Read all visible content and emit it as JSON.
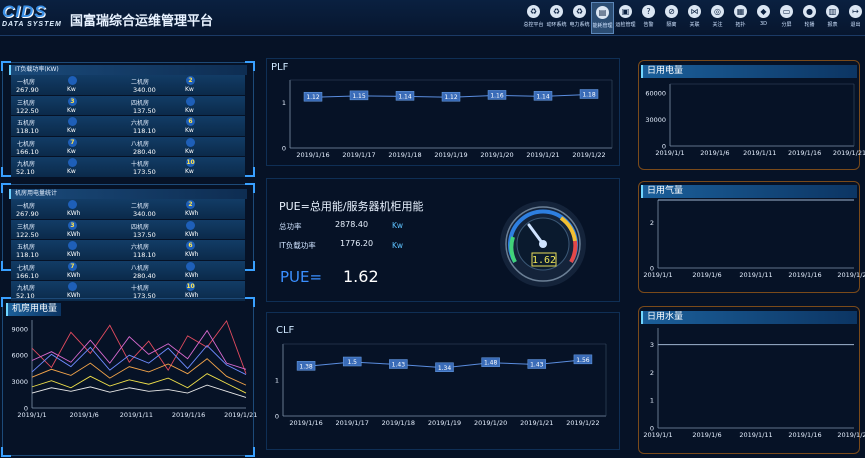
{
  "header": {
    "logo_big": "CIDS",
    "logo_small": "DATA SYSTEM",
    "title": "国富瑞综合运维管理平台",
    "nav": [
      {
        "label": "总控平台",
        "icon": "recycle-icon",
        "glyph": "♻"
      },
      {
        "label": "动环系统",
        "icon": "recycle-icon",
        "glyph": "♻"
      },
      {
        "label": "电力系统",
        "icon": "recycle-icon",
        "glyph": "♻"
      },
      {
        "label": "能耗管理",
        "icon": "bar-chart-icon",
        "glyph": "▤"
      },
      {
        "label": "运检管理",
        "icon": "box-icon",
        "glyph": "▣"
      },
      {
        "label": "告警",
        "icon": "question-icon",
        "glyph": "?"
      },
      {
        "label": "隔离",
        "icon": "slash-icon",
        "glyph": "⊘"
      },
      {
        "label": "关联",
        "icon": "share-icon",
        "glyph": "⋈"
      },
      {
        "label": "关注",
        "icon": "target-icon",
        "glyph": "◎"
      },
      {
        "label": "拓扑",
        "icon": "grid-icon",
        "glyph": "▦"
      },
      {
        "label": "3D",
        "icon": "cube-icon",
        "glyph": "◆"
      },
      {
        "label": "分屏",
        "icon": "screen-icon",
        "glyph": "▭"
      },
      {
        "label": "轮播",
        "icon": "pin-icon",
        "glyph": "●"
      },
      {
        "label": "报表",
        "icon": "doc-icon",
        "glyph": "▥"
      },
      {
        "label": "退出",
        "icon": "exit-icon",
        "glyph": "↦"
      }
    ],
    "active_nav": 3
  },
  "it_load": {
    "title": "IT负载功率(KW)",
    "rows": [
      {
        "left_name": "一机房",
        "left_val": "267.90",
        "left_num": "",
        "right_name": "二机房",
        "right_val": "340.00",
        "right_num": "2",
        "unit": "Kw"
      },
      {
        "left_name": "三机房",
        "left_val": "122.50",
        "left_num": "3",
        "right_name": "四机房",
        "right_val": "137.50",
        "right_num": "",
        "unit": "Kw"
      },
      {
        "left_name": "五机房",
        "left_val": "118.10",
        "left_num": "",
        "right_name": "六机房",
        "right_val": "118.10",
        "right_num": "6",
        "unit": "Kw"
      },
      {
        "left_name": "七机房",
        "left_val": "166.10",
        "left_num": "7",
        "right_name": "八机房",
        "right_val": "280.40",
        "right_num": "",
        "unit": "Kw"
      },
      {
        "left_name": "九机房",
        "left_val": "52.10",
        "left_num": "",
        "right_name": "十机房",
        "right_val": "173.50",
        "right_num": "10",
        "unit": "Kw"
      }
    ]
  },
  "room_power": {
    "title": "机房用电量统计",
    "rows": [
      {
        "left_name": "一机房",
        "left_val": "267.90",
        "left_num": "",
        "right_name": "二机房",
        "right_val": "340.00",
        "right_num": "2",
        "unit": "KWh"
      },
      {
        "left_name": "三机房",
        "left_val": "122.50",
        "left_num": "3",
        "right_name": "四机房",
        "right_val": "137.50",
        "right_num": "",
        "unit": "KWh"
      },
      {
        "left_name": "五机房",
        "left_val": "118.10",
        "left_num": "",
        "right_name": "六机房",
        "right_val": "118.10",
        "right_num": "6",
        "unit": "KWh"
      },
      {
        "left_name": "七机房",
        "left_val": "166.10",
        "left_num": "7",
        "right_name": "八机房",
        "right_val": "280.40",
        "right_num": "",
        "unit": "KWh"
      },
      {
        "left_name": "九机房",
        "left_val": "52.10",
        "left_num": "",
        "right_name": "十机房",
        "right_val": "173.50",
        "right_num": "10",
        "unit": "KWh"
      }
    ]
  },
  "pue": {
    "formula": "PUE=总用能/服务器机柜用能",
    "total_label": "总功率",
    "total_value": "2878.40",
    "total_unit": "Kw",
    "it_label": "IT负载功率",
    "it_value": "1776.20",
    "it_unit": "Kw",
    "pue_label": "PUE=",
    "pue_value": "1.62",
    "gauge_value": "1.62"
  },
  "chart_data": [
    {
      "id": "plf",
      "type": "line",
      "title": "PLF",
      "x": [
        "2019/1/16",
        "2019/1/17",
        "2019/1/18",
        "2019/1/19",
        "2019/1/20",
        "2019/1/21",
        "2019/1/22"
      ],
      "series": [
        {
          "values": [
            1.12,
            1.15,
            1.14,
            1.12,
            1.16,
            1.14,
            1.18
          ]
        }
      ],
      "ylim": [
        0,
        1.5
      ],
      "yticks": [
        0,
        1
      ],
      "data_labels": [
        "1.12",
        "1.15",
        "1.14",
        "1.12",
        "1.16",
        "1.14",
        "1.18"
      ]
    },
    {
      "id": "clf",
      "type": "line",
      "title": "CLF",
      "x": [
        "2019/1/16",
        "2019/1/17",
        "2019/1/18",
        "2019/1/19",
        "2019/1/20",
        "2019/1/21",
        "2019/1/22"
      ],
      "series": [
        {
          "values": [
            1.38,
            1.5,
            1.43,
            1.34,
            1.48,
            1.43,
            1.56
          ]
        }
      ],
      "ylim": [
        0,
        2
      ],
      "yticks": [
        0,
        1
      ],
      "data_labels": [
        "1.38",
        "1.5",
        "1.43",
        "1.34",
        "1.48",
        "1.43",
        "1.56"
      ]
    },
    {
      "id": "room_power_trend",
      "type": "line",
      "title": "机房用电量",
      "x": [
        "2019/1/1",
        "2019/1/6",
        "2019/1/11",
        "2019/1/16",
        "2019/1/21"
      ],
      "ylim": [
        0,
        10000
      ],
      "yticks": [
        0,
        3000,
        6000,
        9000
      ],
      "series": [
        {
          "values": [
            6800,
            4600,
            8600,
            6200,
            9400,
            5200,
            7600,
            4300,
            8200,
            6900,
            9900,
            3900
          ],
          "color": "#e24b5f"
        },
        {
          "values": [
            5400,
            6400,
            5200,
            7700,
            5100,
            8100,
            6100,
            7300,
            5600,
            8800,
            5100,
            4400
          ],
          "color": "#d86ad0"
        },
        {
          "values": [
            4100,
            6100,
            4700,
            6900,
            4300,
            6000,
            5100,
            6800,
            4500,
            7100,
            4900,
            3800
          ],
          "color": "#6f8cff"
        },
        {
          "values": [
            3500,
            4400,
            3700,
            5100,
            3400,
            4700,
            4100,
            5000,
            3900,
            5600,
            3600,
            2600
          ],
          "color": "#f3a44a"
        },
        {
          "values": [
            2400,
            3100,
            2300,
            3600,
            2500,
            3200,
            2700,
            3400,
            2300,
            3900,
            2800,
            1700
          ],
          "color": "#f0e04a"
        },
        {
          "values": [
            1700,
            2300,
            1900,
            2400,
            1800,
            2300,
            1900,
            2100,
            1700,
            2600,
            1900,
            1200
          ],
          "color": "#e8e8e8"
        }
      ]
    },
    {
      "id": "daily_power",
      "type": "line",
      "title": "日用电量",
      "x": [
        "2019/1/1",
        "2019/1/6",
        "2019/1/11",
        "2019/1/16",
        "2019/1/21"
      ],
      "ylim": [
        0,
        70000
      ],
      "yticks": [
        0,
        30000,
        60000
      ],
      "series": []
    },
    {
      "id": "daily_gas",
      "type": "line",
      "title": "日用气量",
      "x": [
        "2019/1/1",
        "2019/1/6",
        "2019/1/11",
        "2019/1/16",
        "2019/1/21"
      ],
      "ylim": [
        0,
        3
      ],
      "yticks": [
        0,
        2
      ],
      "series": [
        {
          "values": [
            3,
            3,
            3,
            3,
            3
          ]
        }
      ]
    },
    {
      "id": "daily_water",
      "type": "line",
      "title": "日用水量",
      "x": [
        "2019/1/1",
        "2019/1/6",
        "2019/1/11",
        "2019/1/16",
        "2019/1/21"
      ],
      "ylim": [
        0,
        3.6
      ],
      "yticks": [
        0,
        1,
        2,
        3
      ],
      "series": [
        {
          "values": [
            3,
            3,
            3,
            3,
            3
          ]
        }
      ]
    }
  ],
  "colors": {
    "accent": "#39a0ff",
    "line": "#5a8ddf",
    "label_bg": "#3a6cb8",
    "frame": "#1d4a78"
  }
}
